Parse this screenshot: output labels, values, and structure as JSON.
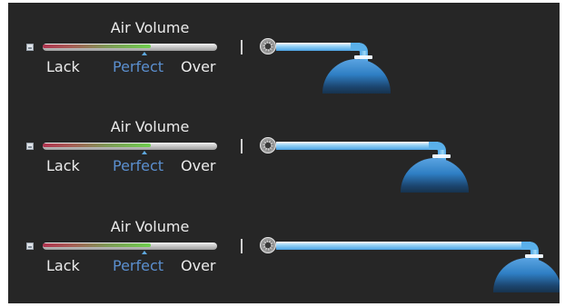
{
  "rows": [
    {
      "title": "Air Volume",
      "labels": {
        "lack": "Lack",
        "perfect": "Perfect",
        "over": "Over"
      },
      "level": 0.62,
      "icons": {
        "toggle": "square-toggle-icon",
        "fan": "fan-icon",
        "hood": "hood-icon"
      }
    },
    {
      "title": "Air Volume",
      "labels": {
        "lack": "Lack",
        "perfect": "Perfect",
        "over": "Over"
      },
      "level": 0.62,
      "icons": {
        "toggle": "square-toggle-icon",
        "fan": "fan-icon",
        "hood": "hood-icon"
      }
    },
    {
      "title": "Air Volume",
      "labels": {
        "lack": "Lack",
        "perfect": "Perfect",
        "over": "Over"
      },
      "level": 0.62,
      "icons": {
        "toggle": "square-toggle-icon",
        "fan": "fan-icon",
        "hood": "hood-icon"
      }
    }
  ],
  "colors": {
    "panel_bg": "#262626",
    "text": "#ececec",
    "perfect_text": "#5b8fcf",
    "pipe_blue": "#5ab0ea",
    "hood_blue": "#2f7fc4"
  }
}
